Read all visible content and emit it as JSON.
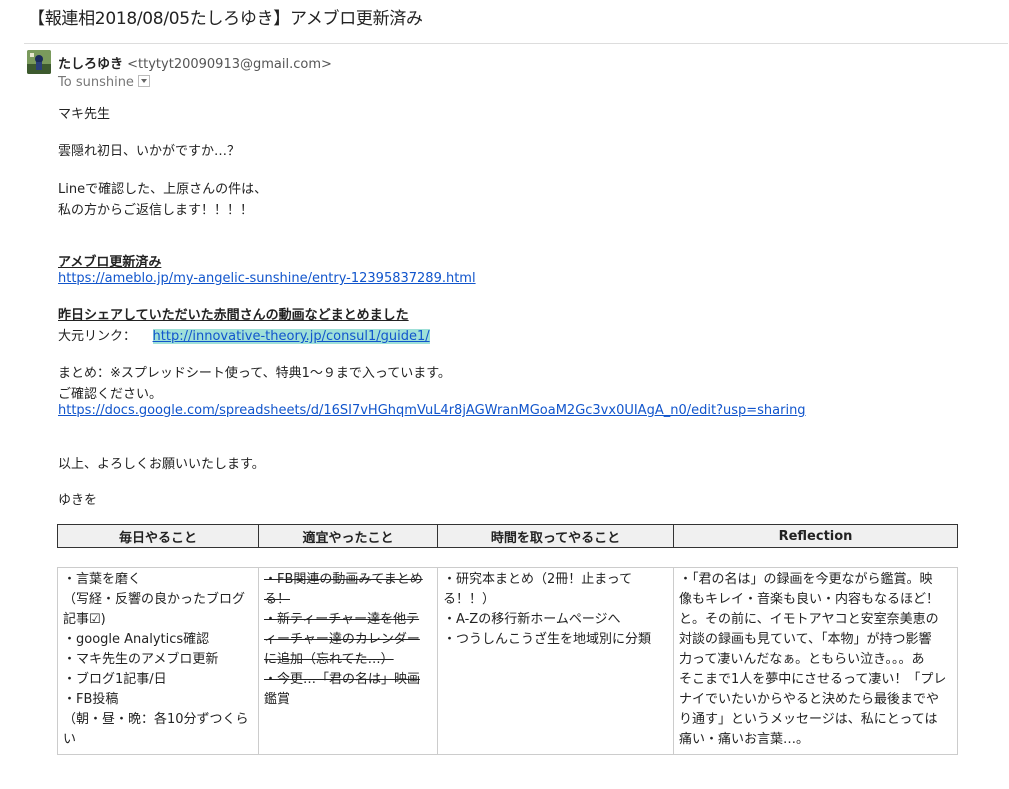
{
  "subject": "【報連相2018/08/05たしろゆき】アメブロ更新済み",
  "sender": {
    "name": "たしろゆき",
    "email": "<ttytyt20090913@gmail.com>",
    "to": "To sunshine"
  },
  "body": {
    "greeting": "マキ先生",
    "line1": "雲隠れ初日、いかがですか…？",
    "line2a": "Lineで確認した、上原さんの件は、",
    "line2b": "私の方からご返信します！！！！",
    "ameblo_heading": "アメブロ更新済み",
    "ameblo_link": "https://ameblo.jp/my-angelic-sunshine/entry-12395837289.html",
    "video_heading": "昨日シェアしていただいた赤間さんの動画などまとめました",
    "source_label": "大元リンク：",
    "source_link": "http://innovative-theory.jp/consul1/guide1/",
    "summary_a": "まとめ：※スプレッドシート使って、特典1～９まで入っています。",
    "summary_b": "ご確認ください。",
    "sheet_link": "https://docs.google.com/spreadsheets/d/16SI7vHGhqmVuL4r8jAGWranMGoaM2Gc3vx0UIAgA_n0/edit?usp=sharing",
    "closing": "以上、よろしくお願いいたします。",
    "signature": "ゆきを"
  },
  "table": {
    "headers": [
      "毎日やること",
      "適宜やったこと",
      "時間を取ってやること",
      "Reflection"
    ],
    "col1": [
      "・言葉を磨く",
      "（写経・反響の良かったブログ",
      "記事☑)",
      "・google Analytics確認",
      "・マキ先生のアメブロ更新",
      "・ブログ1記事/日",
      "・FB投稿",
      "（朝・昼・晩：各10分ずつくら",
      "い"
    ],
    "col2": [
      "・FB関連の動画みてまとめ",
      "る！",
      "・新ティーチャー達を他テ",
      "ィーチャー達のカレンダー",
      "に追加（忘れてた…）",
      "・今更…「君の名は」映画",
      "鑑賞"
    ],
    "col2_struck": [
      true,
      true,
      true,
      true,
      true,
      true,
      false
    ],
    "col3": [
      "・研究本まとめ（2冊！止まって",
      "る！！）",
      "・A-Zの移行新ホームページへ",
      "・つうしんこうざ生を地域別に分類"
    ],
    "col4": [
      "・「君の名は」の録画を今更ながら鑑賞。映",
      "像もキレイ・音楽も良い・内容もなるほど！",
      "と。その前に、イモトアヤコと安室奈美恵の",
      "対談の録画も見ていて、「本物」が持つ影響",
      "力って凄いんだなぁ。ともらい泣き。。。あ",
      "そこまで1人を夢中にさせるって凄い！「プレ",
      "ナイでいたいからやると決めたら最後までや",
      "り通す」というメッセージは、私にとっては",
      "痛い・痛いお言葉…。"
    ]
  },
  "colors": {
    "link": "#1155cc",
    "highlight": "#9fe0d8"
  }
}
